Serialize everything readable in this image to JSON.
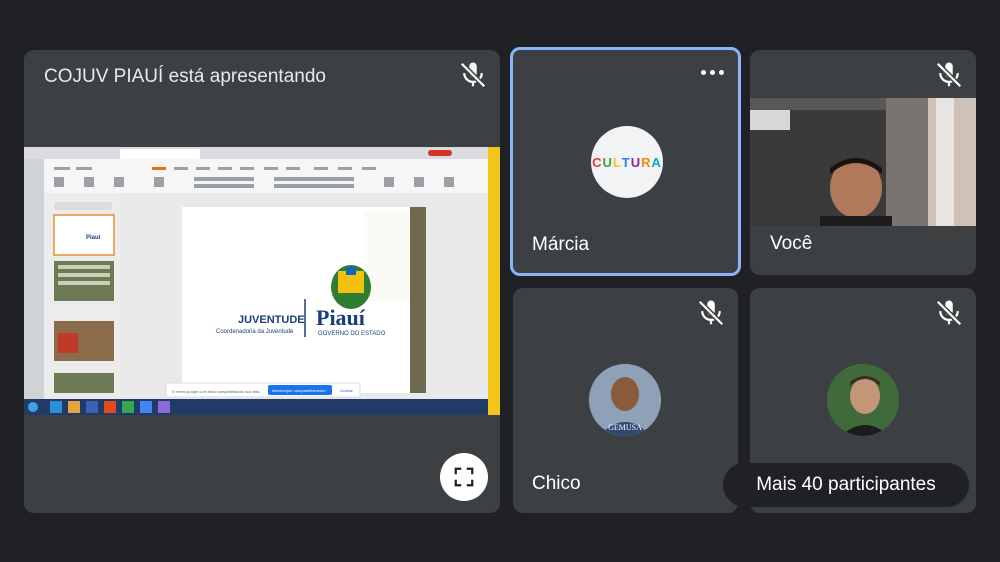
{
  "presenter": {
    "title": "COJUV PIAUÍ está apresentando",
    "slide": {
      "left_text": "JUVENTUDE",
      "left_subtext": "Coordenadoria da Juventude",
      "right_text": "Piauí",
      "right_subtext": "GOVERNO DO ESTADO"
    },
    "screen_notice": {
      "message": "O meet.google.com está compartilhando sua tela.",
      "stop_label": "Interromper compartilhamento",
      "hide_label": "Ocultar"
    }
  },
  "participants": [
    {
      "name": "Márcia",
      "avatar_text": "CULTURA",
      "speaking": true
    },
    {
      "name": "Você",
      "video": true
    },
    {
      "name": "Chico",
      "avatar_caption": "GEMUSA"
    },
    {
      "name": "",
      "avatar": true
    }
  ],
  "more_participants_label": "Mais 40 participantes",
  "colors": {
    "background": "#202124",
    "tile": "#3c4043",
    "active_border": "#8ab4f8"
  },
  "icons": {
    "mic_off": "mic-off-icon",
    "fullscreen": "fullscreen-icon",
    "more": "more-options-icon"
  }
}
